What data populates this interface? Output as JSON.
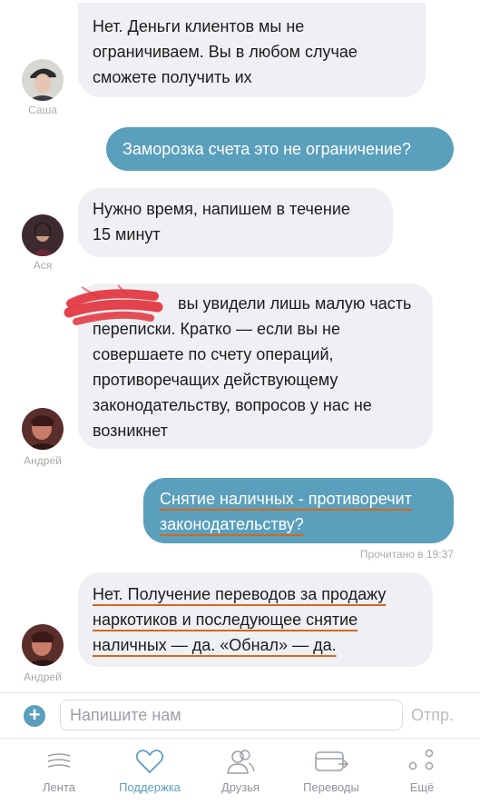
{
  "messages": [
    {
      "id": "m1",
      "direction": "in",
      "sender": "Саша",
      "lines": [
        "Нет. Деньги клиентов мы не",
        "ограничиваем. Вы в любом случае",
        "сможете получить их"
      ]
    },
    {
      "id": "m2",
      "direction": "out",
      "lines": [
        "Заморозка счета это не ограничение?"
      ]
    },
    {
      "id": "m3",
      "direction": "in",
      "sender": "Ася",
      "lines": [
        "Нужно время, напишем в течение",
        "15 минут"
      ]
    },
    {
      "id": "m4",
      "direction": "in",
      "sender": "Андрей",
      "lines": [
        "вы увидели лишь малую часть",
        "переписки. Кратко — если вы не",
        "совершаете по счету операций,",
        "противоречащих действующему",
        "законодательству, вопросов у нас не",
        "возникнет"
      ]
    },
    {
      "id": "m5",
      "direction": "out",
      "lines": [
        "Снятие наличных - противоречит",
        "законодательству?"
      ]
    },
    {
      "id": "m6",
      "direction": "in",
      "sender": "Андрей",
      "lines": [
        "Нет. Получение переводов за продажу",
        "наркотиков и последующее снятие",
        "наличных — да. «Обнал» — да."
      ]
    }
  ],
  "read_receipt": "Прочитано в 19:37",
  "input": {
    "placeholder": "Напишите нам",
    "send_label": "Отпр."
  },
  "tabs": [
    {
      "label": "Лента",
      "icon": "feed-icon",
      "active": false
    },
    {
      "label": "Поддержка",
      "icon": "heart-icon",
      "active": true
    },
    {
      "label": "Друзья",
      "icon": "friends-icon",
      "active": false
    },
    {
      "label": "Переводы",
      "icon": "transfers-icon",
      "active": false
    },
    {
      "label": "Ещё",
      "icon": "more-icon",
      "active": false
    }
  ],
  "colors": {
    "accent": "#5a9fbb",
    "incoming_bubble": "#eef0f3",
    "underline": "#d2691e",
    "redaction": "#e0303a"
  }
}
